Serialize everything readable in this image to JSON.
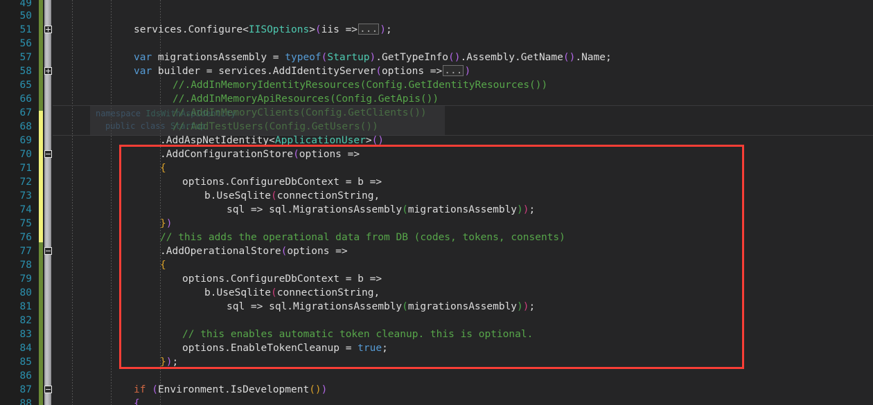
{
  "editor": {
    "theme": "visual-studio-dark",
    "language": "csharp",
    "background": "#252526",
    "gutter_background": "#1e1e1e",
    "line_number_color": "#2b91af",
    "annotation_rect_color": "#f93e36",
    "change_marker_saved_color": "#6a8a35",
    "change_marker_unsaved_color": "#f0f07a"
  },
  "sticky_overlay": {
    "line1_keyword": "namespace",
    "line1_name": "IdsWithAspIdentity",
    "line2_keyword": "public class",
    "line2_name": "Startup"
  },
  "lines": [
    {
      "num": "49",
      "text": ""
    },
    {
      "num": "50",
      "text": ""
    },
    {
      "num": "51",
      "text": "services.Configure<IISOptions>(iis =>...);"
    },
    {
      "num": "56",
      "text": ""
    },
    {
      "num": "57",
      "text": "var migrationsAssembly = typeof(Startup).GetTypeInfo().Assembly.GetName().Name;"
    },
    {
      "num": "58",
      "text": "var builder = services.AddIdentityServer(options =>...)"
    },
    {
      "num": "65",
      "text": "//.AddInMemoryIdentityResources(Config.GetIdentityResources())"
    },
    {
      "num": "66",
      "text": "//.AddInMemoryApiResources(Config.GetApis())"
    },
    {
      "num": "67",
      "text": "//.AddInMemoryClients(Config.GetClients())"
    },
    {
      "num": "68",
      "text": "//.AddTestUsers(Config.GetUsers())"
    },
    {
      "num": "69",
      "text": ".AddAspNetIdentity<ApplicationUser>()"
    },
    {
      "num": "70",
      "text": ".AddConfigurationStore(options =>"
    },
    {
      "num": "71",
      "text": "{"
    },
    {
      "num": "72",
      "text": "options.ConfigureDbContext = b =>"
    },
    {
      "num": "73",
      "text": "b.UseSqlite(connectionString,"
    },
    {
      "num": "74",
      "text": "sql => sql.MigrationsAssembly(migrationsAssembly));"
    },
    {
      "num": "75",
      "text": "})"
    },
    {
      "num": "76",
      "text": "// this adds the operational data from DB (codes, tokens, consents)"
    },
    {
      "num": "77",
      "text": ".AddOperationalStore(options =>"
    },
    {
      "num": "78",
      "text": "{"
    },
    {
      "num": "79",
      "text": "options.ConfigureDbContext = b =>"
    },
    {
      "num": "80",
      "text": "b.UseSqlite(connectionString,"
    },
    {
      "num": "81",
      "text": "sql => sql.MigrationsAssembly(migrationsAssembly));"
    },
    {
      "num": "82",
      "text": ""
    },
    {
      "num": "83",
      "text": "// this enables automatic token cleanup. this is optional."
    },
    {
      "num": "84",
      "text": "options.EnableTokenCleanup = true;"
    },
    {
      "num": "85",
      "text": "});"
    },
    {
      "num": "86",
      "text": ""
    },
    {
      "num": "87",
      "text": "if (Environment.IsDevelopment())"
    },
    {
      "num": "88",
      "text": "{"
    }
  ],
  "outline_markers": [
    {
      "line": "51",
      "state": "collapsed"
    },
    {
      "line": "58",
      "state": "collapsed"
    },
    {
      "line": "70",
      "state": "expanded"
    },
    {
      "line": "77",
      "state": "expanded"
    },
    {
      "line": "87",
      "state": "expanded"
    }
  ]
}
